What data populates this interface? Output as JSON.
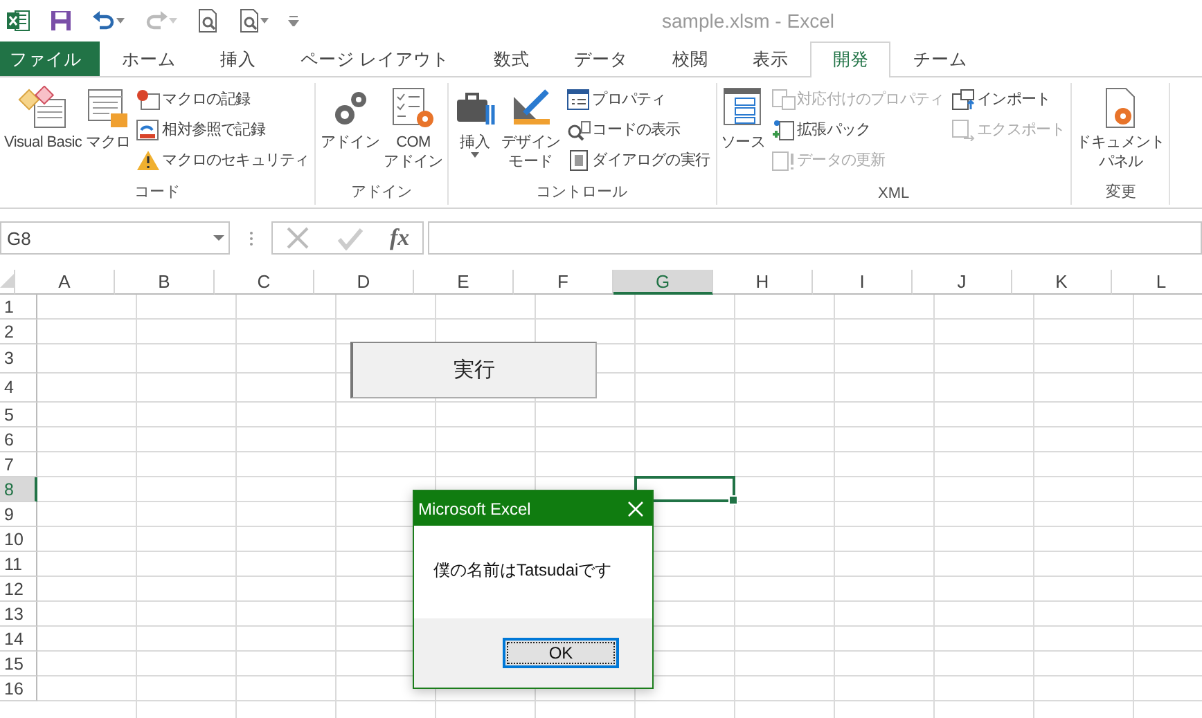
{
  "window": {
    "title": "sample.xlsm - Excel"
  },
  "tabs": [
    {
      "label": "ファイル",
      "kind": "file",
      "selected": false
    },
    {
      "label": "ホーム",
      "kind": "tab",
      "selected": false
    },
    {
      "label": "挿入",
      "kind": "tab",
      "selected": false
    },
    {
      "label": "ページ レイアウト",
      "kind": "tab",
      "selected": false
    },
    {
      "label": "数式",
      "kind": "tab",
      "selected": false
    },
    {
      "label": "データ",
      "kind": "tab",
      "selected": false
    },
    {
      "label": "校閲",
      "kind": "tab",
      "selected": false
    },
    {
      "label": "表示",
      "kind": "tab",
      "selected": false
    },
    {
      "label": "開発",
      "kind": "tab",
      "selected": true
    },
    {
      "label": "チーム",
      "kind": "tab",
      "selected": false
    }
  ],
  "ribbon": {
    "groups": [
      {
        "label": "コード",
        "items": [
          {
            "kind": "large",
            "lines": [
              "Visual Basic"
            ],
            "disabled": false
          },
          {
            "kind": "large",
            "lines": [
              "マクロ"
            ],
            "disabled": false
          },
          {
            "kind": "small",
            "lines": [
              "マクロの記録"
            ],
            "disabled": false
          },
          {
            "kind": "small",
            "lines": [
              "相対参照で記録"
            ],
            "disabled": false
          },
          {
            "kind": "small",
            "lines": [
              "マクロのセキュリティ"
            ],
            "disabled": false
          }
        ]
      },
      {
        "label": "アドイン",
        "items": [
          {
            "kind": "large",
            "lines": [
              "アドイン"
            ],
            "disabled": false
          },
          {
            "kind": "large",
            "lines": [
              "COM",
              "アドイン"
            ],
            "disabled": false
          }
        ]
      },
      {
        "label": "コントロール",
        "items": [
          {
            "kind": "large",
            "lines": [
              "挿入"
            ],
            "disabled": false,
            "dropdown": true
          },
          {
            "kind": "large",
            "lines": [
              "デザイン",
              "モード"
            ],
            "disabled": false
          },
          {
            "kind": "small",
            "lines": [
              "プロパティ"
            ],
            "disabled": false
          },
          {
            "kind": "small",
            "lines": [
              "コードの表示"
            ],
            "disabled": false
          },
          {
            "kind": "small",
            "lines": [
              "ダイアログの実行"
            ],
            "disabled": false
          }
        ]
      },
      {
        "label": "XML",
        "items": [
          {
            "kind": "large",
            "lines": [
              "ソース"
            ],
            "disabled": false
          },
          {
            "kind": "small",
            "lines": [
              "対応付けのプロパティ"
            ],
            "disabled": true
          },
          {
            "kind": "small",
            "lines": [
              "拡張パック"
            ],
            "disabled": false
          },
          {
            "kind": "small",
            "lines": [
              "データの更新"
            ],
            "disabled": true
          },
          {
            "kind": "small",
            "lines": [
              "インポート"
            ],
            "disabled": false
          },
          {
            "kind": "small",
            "lines": [
              "エクスポート"
            ],
            "disabled": true
          }
        ]
      },
      {
        "label": "変更",
        "items": [
          {
            "kind": "large",
            "lines": [
              "ドキュメント",
              "パネル"
            ],
            "disabled": false
          }
        ]
      }
    ]
  },
  "formula_bar": {
    "name_box": "G8",
    "fx_label": "fx"
  },
  "columns": [
    {
      "label": "A",
      "selected": false
    },
    {
      "label": "B",
      "selected": false
    },
    {
      "label": "C",
      "selected": false
    },
    {
      "label": "D",
      "selected": false
    },
    {
      "label": "E",
      "selected": false
    },
    {
      "label": "F",
      "selected": false
    },
    {
      "label": "G",
      "selected": true
    },
    {
      "label": "H",
      "selected": false
    },
    {
      "label": "I",
      "selected": false
    },
    {
      "label": "J",
      "selected": false
    },
    {
      "label": "K",
      "selected": false
    },
    {
      "label": "L",
      "selected": false
    }
  ],
  "rows": [
    {
      "label": "1",
      "selected": false
    },
    {
      "label": "2",
      "selected": false
    },
    {
      "label": "3",
      "selected": false
    },
    {
      "label": "4",
      "selected": false
    },
    {
      "label": "5",
      "selected": false
    },
    {
      "label": "6",
      "selected": false
    },
    {
      "label": "7",
      "selected": false
    },
    {
      "label": "8",
      "selected": true
    },
    {
      "label": "9",
      "selected": false
    },
    {
      "label": "10",
      "selected": false
    },
    {
      "label": "11",
      "selected": false
    },
    {
      "label": "12",
      "selected": false
    },
    {
      "label": "13",
      "selected": false
    },
    {
      "label": "14",
      "selected": false
    },
    {
      "label": "15",
      "selected": false
    },
    {
      "label": "16",
      "selected": false
    }
  ],
  "sheet_button": {
    "label": "実行"
  },
  "dialog": {
    "title": "Microsoft Excel",
    "message": "僕の名前はTatsudaiです",
    "button": "OK"
  }
}
